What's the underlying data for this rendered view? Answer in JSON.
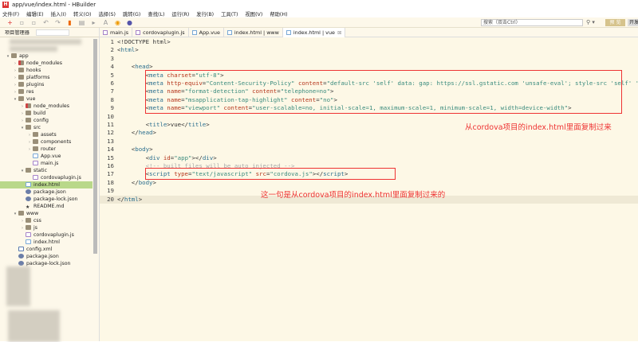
{
  "window": {
    "title": "app/vue/index.html  -  HBuilder",
    "logo": "H"
  },
  "menu": [
    "文件(F)",
    "编辑(E)",
    "插入(I)",
    "转义(O)",
    "选择(S)",
    "跳转(G)",
    "查找(L)",
    "运行(R)",
    "发行(B)",
    "工具(T)",
    "视图(V)",
    "帮助(H)"
  ],
  "toolbar": {
    "search_placeholder": "搜索（双击Ctrl）",
    "preview_label": "预 览",
    "dev_label": "开发"
  },
  "sidebar": {
    "title": "项目管理器",
    "items": [
      {
        "label": "app",
        "depth": 0,
        "type": "proj",
        "open": true
      },
      {
        "label": "node_modules",
        "depth": 1,
        "type": "nm"
      },
      {
        "label": "hooks",
        "depth": 1,
        "type": "folder"
      },
      {
        "label": "platforms",
        "depth": 1,
        "type": "folder"
      },
      {
        "label": "plugins",
        "depth": 1,
        "type": "folder"
      },
      {
        "label": "res",
        "depth": 1,
        "type": "folder"
      },
      {
        "label": "vue",
        "depth": 1,
        "type": "folder",
        "open": true
      },
      {
        "label": "node_modules",
        "depth": 2,
        "type": "nm"
      },
      {
        "label": "build",
        "depth": 2,
        "type": "folder"
      },
      {
        "label": "config",
        "depth": 2,
        "type": "folder"
      },
      {
        "label": "src",
        "depth": 2,
        "type": "folder",
        "open": true
      },
      {
        "label": "assets",
        "depth": 3,
        "type": "folder"
      },
      {
        "label": "components",
        "depth": 3,
        "type": "folder"
      },
      {
        "label": "router",
        "depth": 3,
        "type": "folder"
      },
      {
        "label": "App.vue",
        "depth": 3,
        "type": "vue",
        "leaf": true
      },
      {
        "label": "main.js",
        "depth": 3,
        "type": "js",
        "leaf": true
      },
      {
        "label": "static",
        "depth": 2,
        "type": "folder",
        "open": true
      },
      {
        "label": "cordovaplugin.js",
        "depth": 3,
        "type": "js",
        "leaf": true
      },
      {
        "label": "index.html",
        "depth": 2,
        "type": "html",
        "leaf": true,
        "selected": true
      },
      {
        "label": "package.json",
        "depth": 2,
        "type": "json",
        "leaf": true
      },
      {
        "label": "package-lock.json",
        "depth": 2,
        "type": "json",
        "leaf": true
      },
      {
        "label": "README.md",
        "depth": 2,
        "type": "star",
        "leaf": true
      },
      {
        "label": "www",
        "depth": 1,
        "type": "folder",
        "open": true
      },
      {
        "label": "css",
        "depth": 2,
        "type": "folder"
      },
      {
        "label": "js",
        "depth": 2,
        "type": "folder"
      },
      {
        "label": "cordovaplugin.js",
        "depth": 2,
        "type": "js",
        "leaf": true
      },
      {
        "label": "index.html",
        "depth": 2,
        "type": "html",
        "leaf": true
      },
      {
        "label": "config.xml",
        "depth": 1,
        "type": "xml",
        "leaf": true
      },
      {
        "label": "package.json",
        "depth": 1,
        "type": "json",
        "leaf": true
      },
      {
        "label": "package-lock.json",
        "depth": 1,
        "type": "json",
        "leaf": true
      }
    ]
  },
  "tabs": [
    {
      "label": "main.js",
      "type": "js"
    },
    {
      "label": "cordovaplugin.js",
      "type": "js"
    },
    {
      "label": "App.vue",
      "type": "vue"
    },
    {
      "label": "index.html | www",
      "type": "html"
    },
    {
      "label": "index.html | vue",
      "type": "html",
      "active": true,
      "close": "⊠"
    }
  ],
  "code": [
    [
      [
        "p",
        "<!DOCTYPE html>"
      ]
    ],
    [
      [
        "p",
        "<"
      ],
      [
        "t",
        "html"
      ],
      [
        "p",
        ">"
      ]
    ],
    [],
    [
      [
        "p",
        "    <"
      ],
      [
        "t",
        "head"
      ],
      [
        "p",
        ">"
      ]
    ],
    [
      [
        "p",
        "        <"
      ],
      [
        "t",
        "meta "
      ],
      [
        "a",
        "charset"
      ],
      [
        "p",
        "="
      ],
      [
        "s",
        "\"utf-8\""
      ],
      [
        "p",
        ">"
      ]
    ],
    [
      [
        "p",
        "        <"
      ],
      [
        "t",
        "meta "
      ],
      [
        "a",
        "http-equiv"
      ],
      [
        "p",
        "="
      ],
      [
        "s",
        "\"Content-Security-Policy\""
      ],
      [
        "a",
        " content"
      ],
      [
        "p",
        "="
      ],
      [
        "s",
        "\"default-src 'self' data: gap: https://ssl.gstatic.com 'unsafe-eval'; style-src 'self' 'unsafe-inline'\""
      ],
      [
        "p",
        ">"
      ]
    ],
    [
      [
        "p",
        "        <"
      ],
      [
        "t",
        "meta "
      ],
      [
        "a",
        "name"
      ],
      [
        "p",
        "="
      ],
      [
        "s",
        "\"format-detection\""
      ],
      [
        "a",
        " content"
      ],
      [
        "p",
        "="
      ],
      [
        "s",
        "\"telephone=no\""
      ],
      [
        "p",
        ">"
      ]
    ],
    [
      [
        "p",
        "        <"
      ],
      [
        "t",
        "meta "
      ],
      [
        "a",
        "name"
      ],
      [
        "p",
        "="
      ],
      [
        "s",
        "\"msapplication-tap-highlight\""
      ],
      [
        "a",
        " content"
      ],
      [
        "p",
        "="
      ],
      [
        "s",
        "\"no\""
      ],
      [
        "p",
        ">"
      ]
    ],
    [
      [
        "p",
        "        <"
      ],
      [
        "t",
        "meta "
      ],
      [
        "a",
        "name"
      ],
      [
        "p",
        "="
      ],
      [
        "s",
        "\"viewport\""
      ],
      [
        "a",
        " content"
      ],
      [
        "p",
        "="
      ],
      [
        "s",
        "\"user-scalable=no, initial-scale=1, maximum-scale=1, minimum-scale=1, width=device-width\""
      ],
      [
        "p",
        ">"
      ]
    ],
    [],
    [
      [
        "p",
        "        <"
      ],
      [
        "t",
        "title"
      ],
      [
        "p",
        ">vue</"
      ],
      [
        "t",
        "title"
      ],
      [
        "p",
        ">"
      ]
    ],
    [
      [
        "p",
        "    </"
      ],
      [
        "t",
        "head"
      ],
      [
        "p",
        ">"
      ]
    ],
    [],
    [
      [
        "p",
        "    <"
      ],
      [
        "t",
        "body"
      ],
      [
        "p",
        ">"
      ]
    ],
    [
      [
        "p",
        "        <"
      ],
      [
        "t",
        "div "
      ],
      [
        "a",
        "id"
      ],
      [
        "p",
        "="
      ],
      [
        "s",
        "\"app\""
      ],
      [
        "p",
        "></"
      ],
      [
        "t",
        "div"
      ],
      [
        "p",
        ">"
      ]
    ],
    [
      [
        "c",
        "        <!-- built files will be auto injected -->"
      ]
    ],
    [
      [
        "p",
        "        <"
      ],
      [
        "t",
        "script "
      ],
      [
        "a",
        "type"
      ],
      [
        "p",
        "="
      ],
      [
        "s",
        "\"text/javascript\""
      ],
      [
        "a",
        " src"
      ],
      [
        "p",
        "="
      ],
      [
        "s",
        "\"cordova.js\""
      ],
      [
        "p",
        "></"
      ],
      [
        "t",
        "script"
      ],
      [
        "p",
        ">"
      ]
    ],
    [
      [
        "p",
        "    </"
      ],
      [
        "t",
        "body"
      ],
      [
        "p",
        ">"
      ]
    ],
    [],
    [
      [
        "p",
        "</"
      ],
      [
        "t",
        "html"
      ],
      [
        "p",
        ">"
      ]
    ]
  ],
  "annotations": {
    "note1": "从cordova项目的index.html里面复制过来",
    "note2": "这一句是从cordova项目的index.html里面复制过来的"
  }
}
